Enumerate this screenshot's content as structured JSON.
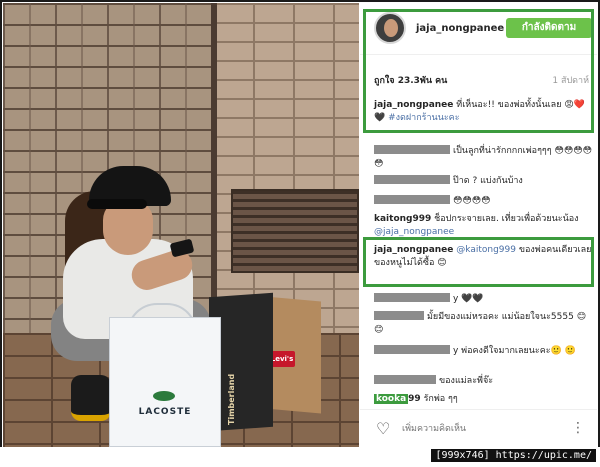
{
  "header": {
    "username": "jaja_nongpanee",
    "follow_label": "กำลังติดตาม"
  },
  "post": {
    "likes": "ถูกใจ 23.3พัน คน",
    "time": "1 สัปดาห์"
  },
  "caption": {
    "user": "jaja_nongpanee",
    "text": "ที่เห็นอะ!! ของพ่อทั้งนั้นเลย 😡❤️🖤",
    "hashtag": "#งดฝากร้านนะคะ"
  },
  "comments": [
    {
      "user": "",
      "text": "เป็นลูกที่น่ารักกกกเพ่อๆๆๆ 😳😳😳😳😳"
    },
    {
      "user": "",
      "text": "ป๊าด ? แบ่งกันบ้าง"
    },
    {
      "user": "",
      "text": "😳😳😳😳"
    },
    {
      "user": "kaitong999",
      "text": "ช็อปกระจายเลย. เที่ยวเพื่อด้วยนะน้อง",
      "mention": "@jaja_nongpanee"
    },
    {
      "user": "jaja_nongpanee",
      "mention": "@kaitong999",
      "text": "ของพ่อคนเดียวเลย ของหนูไม่ได้ซื้อ 😊"
    },
    {
      "user": "",
      "text": "y 🖤🖤"
    },
    {
      "user": "",
      "text": "มั้ยมีของแม่หรอคะ แม่น้อยใจนะ5555 😊😊"
    },
    {
      "user": "",
      "text": "y พ่อคงดีใจมากเลยนะคะ🙂 🙂"
    },
    {
      "user": "",
      "text": "ของแม่ละพี่จ๊ะ"
    },
    {
      "user": "kooka",
      "suffix": "99",
      "text": "รักพ่อ ๆๆ"
    }
  ],
  "footer": {
    "placeholder": "เพิ่มความคิดเห็น",
    "more_icon": "more-options-icon",
    "heart_icon": "heart-icon"
  },
  "photo": {
    "bag_lacoste": "LACOSTE",
    "bag_timberland": "Timberland",
    "bag_levis": "Levi's"
  },
  "watermark": "[999x746] https://upic.me/",
  "colors": {
    "follow_button": "#6cc24a",
    "highlight": "#3c9b3e",
    "link": "#4a6fa5"
  }
}
